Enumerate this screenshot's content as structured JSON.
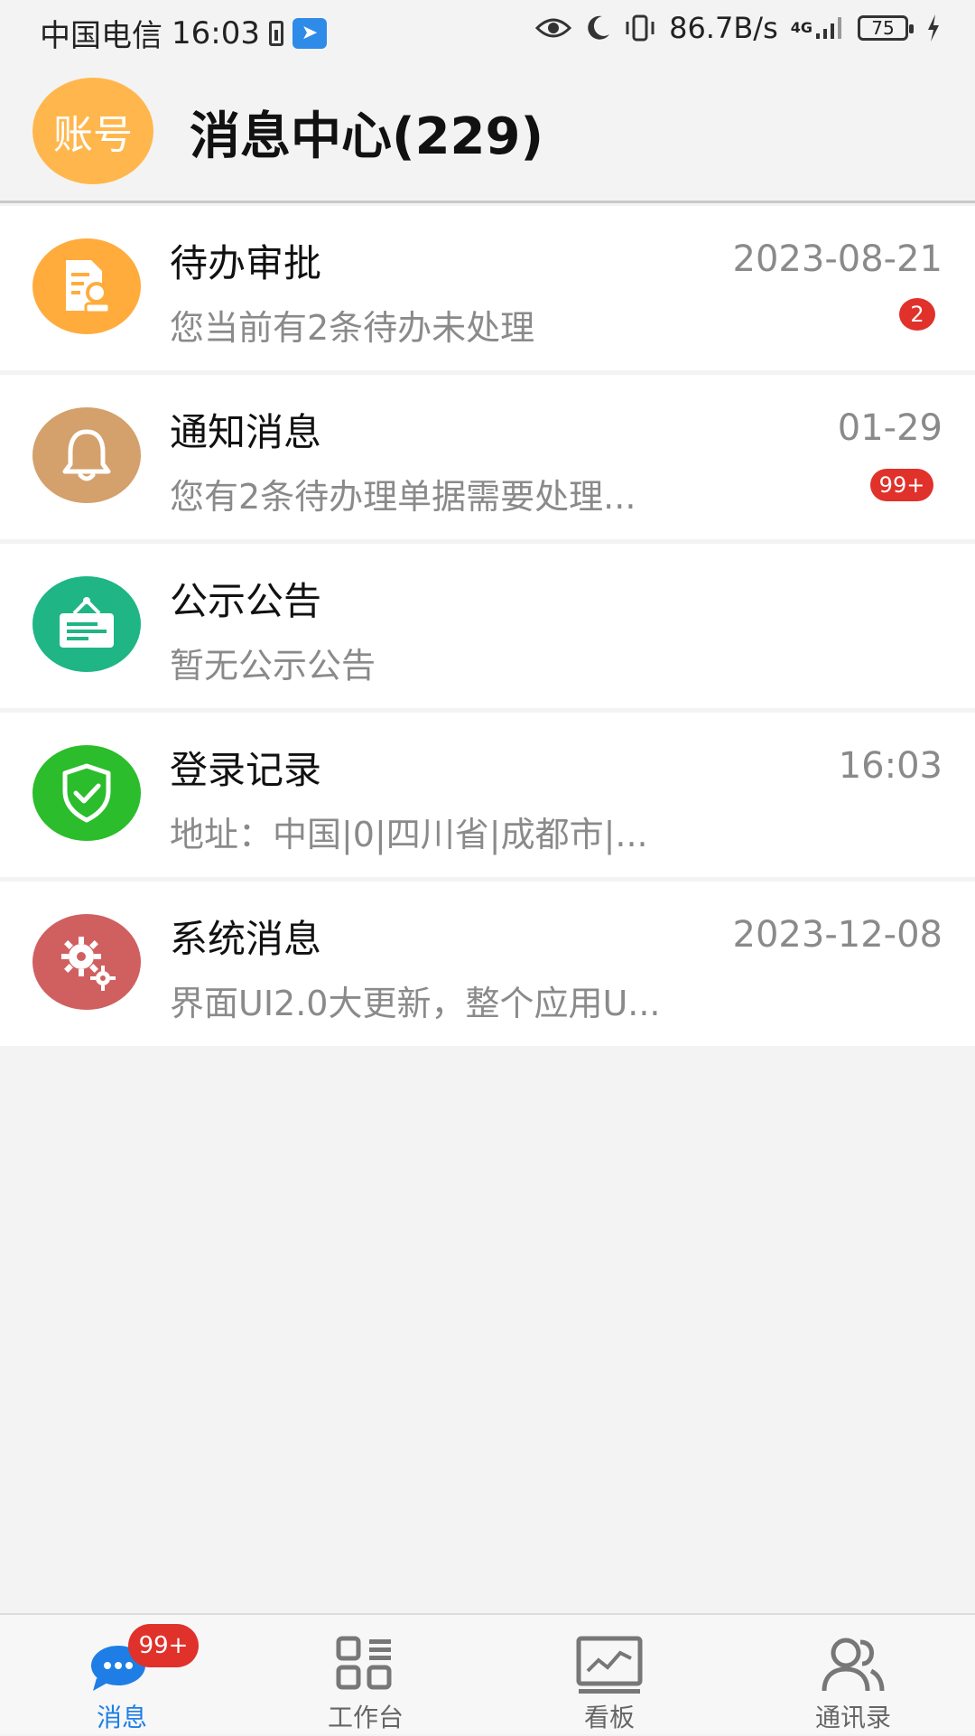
{
  "status_bar": {
    "carrier": "中国电信",
    "time": "16:03",
    "net_speed": "86.7B/s",
    "signal_label": "4G",
    "battery": "75",
    "icons": [
      "battery-small-icon",
      "app-icon",
      "eye-icon",
      "moon-icon",
      "vibrate-icon",
      "signal-icon",
      "battery-icon",
      "charging-icon"
    ]
  },
  "header": {
    "avatar_text": "账号",
    "title": "消息中心(229)"
  },
  "colors": {
    "approval": "#ffac3d",
    "notice": "#d4a06b",
    "bulletin": "#1fb584",
    "login": "#2bbd2b",
    "system": "#d06060",
    "badge": "#e0312b",
    "active": "#1e7ee6"
  },
  "messages": [
    {
      "title": "待办审批",
      "subtitle": "您当前有2条待办未处理",
      "date": "2023-08-21",
      "badge": "2",
      "icon": "approval-doc-icon"
    },
    {
      "title": "通知消息",
      "subtitle": "您有2条待办理单据需要处理...",
      "date": "01-29",
      "badge": "99+",
      "icon": "bell-icon"
    },
    {
      "title": "公示公告",
      "subtitle": "暂无公示公告",
      "date": "",
      "badge": "",
      "icon": "signboard-icon"
    },
    {
      "title": "登录记录",
      "subtitle": "地址：中国|0|四川省|成都市|...",
      "date": "16:03",
      "badge": "",
      "icon": "shield-check-icon"
    },
    {
      "title": "系统消息",
      "subtitle": "界面UI2.0大更新，整个应用U...",
      "date": "2023-12-08",
      "badge": "",
      "icon": "gears-icon"
    }
  ],
  "bottom_nav": {
    "items": [
      {
        "label": "消息",
        "icon": "chat-bubble-icon",
        "badge": "99+"
      },
      {
        "label": "工作台",
        "icon": "grid-list-icon"
      },
      {
        "label": "看板",
        "icon": "chart-board-icon"
      },
      {
        "label": "通讯录",
        "icon": "contacts-icon"
      }
    ]
  }
}
